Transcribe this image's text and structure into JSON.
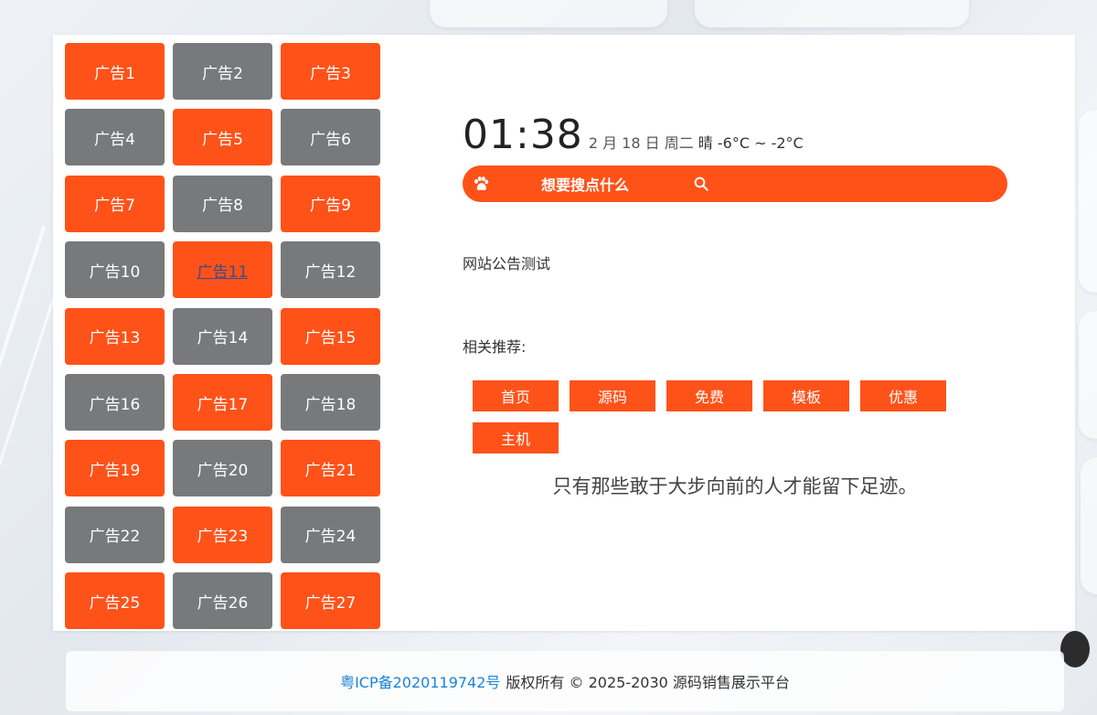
{
  "ads": [
    {
      "label": "广告1",
      "color": "orange"
    },
    {
      "label": "广告2",
      "color": "gray"
    },
    {
      "label": "广告3",
      "color": "orange"
    },
    {
      "label": "广告4",
      "color": "gray"
    },
    {
      "label": "广告5",
      "color": "orange"
    },
    {
      "label": "广告6",
      "color": "gray"
    },
    {
      "label": "广告7",
      "color": "orange"
    },
    {
      "label": "广告8",
      "color": "gray"
    },
    {
      "label": "广告9",
      "color": "orange"
    },
    {
      "label": "广告10",
      "color": "gray"
    },
    {
      "label": "广告11",
      "color": "orange",
      "hovered": true
    },
    {
      "label": "广告12",
      "color": "gray"
    },
    {
      "label": "广告13",
      "color": "orange"
    },
    {
      "label": "广告14",
      "color": "gray"
    },
    {
      "label": "广告15",
      "color": "orange"
    },
    {
      "label": "广告16",
      "color": "gray"
    },
    {
      "label": "广告17",
      "color": "orange"
    },
    {
      "label": "广告18",
      "color": "gray"
    },
    {
      "label": "广告19",
      "color": "orange"
    },
    {
      "label": "广告20",
      "color": "gray"
    },
    {
      "label": "广告21",
      "color": "orange"
    },
    {
      "label": "广告22",
      "color": "gray"
    },
    {
      "label": "广告23",
      "color": "orange"
    },
    {
      "label": "广告24",
      "color": "gray"
    },
    {
      "label": "广告25",
      "color": "orange"
    },
    {
      "label": "广告26",
      "color": "gray"
    },
    {
      "label": "广告27",
      "color": "orange"
    }
  ],
  "clock": {
    "time": "01:38",
    "date": "2 月 18 日 周二",
    "weather": "晴 -6°C ~ -2°C"
  },
  "search": {
    "placeholder": "想要搜点什么",
    "icon_left": "paw-icon",
    "icon_right": "search-icon"
  },
  "notice": "网站公告测试",
  "recommend": {
    "title": "相关推荐:",
    "tags": [
      "首页",
      "源码",
      "免费",
      "模板",
      "优惠",
      "主机"
    ]
  },
  "quote": "只有那些敢于大步向前的人才能留下足迹。",
  "footer": {
    "icp": "粤ICP备2020119742号",
    "copyright": "版权所有 © 2025-2030 源码销售展示平台"
  },
  "colors": {
    "accent": "#ff5219",
    "gray": "#77797b",
    "link": "#1a85d6"
  }
}
